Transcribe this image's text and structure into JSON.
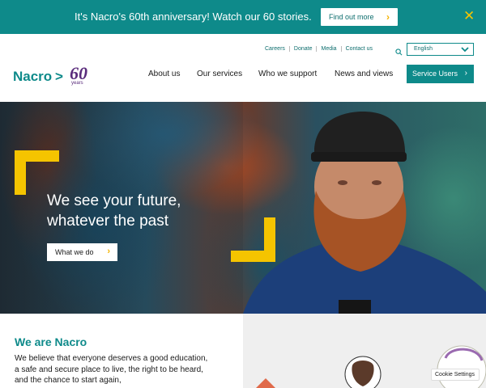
{
  "banner": {
    "text": "It's Nacro's 60th anniversary! Watch our 60 stories.",
    "button_label": "Find out more",
    "close_icon": "close-icon"
  },
  "utility_links": [
    "Careers",
    "Donate",
    "Media",
    "Contact us"
  ],
  "language": {
    "selected": "English"
  },
  "logo": {
    "name": "Nacro",
    "anniversary": "60",
    "anniversary_suffix": "years"
  },
  "nav": {
    "items": [
      "About us",
      "Our services",
      "Who we support",
      "News and views"
    ],
    "cta_label": "Service Users"
  },
  "hero": {
    "heading_line1": "We see your future,",
    "heading_line2": "whatever the past",
    "button_label": "What we do"
  },
  "about": {
    "title": "We are Nacro",
    "body": "We believe that everyone deserves a good education, a safe and secure place to live, the right to be heard, and the chance to start again,"
  },
  "cookie": {
    "label": "Cookie Settings"
  },
  "colors": {
    "brand_teal": "#0e8a8a",
    "accent_yellow": "#f5c400",
    "logo_purple": "#5a2c7c"
  }
}
